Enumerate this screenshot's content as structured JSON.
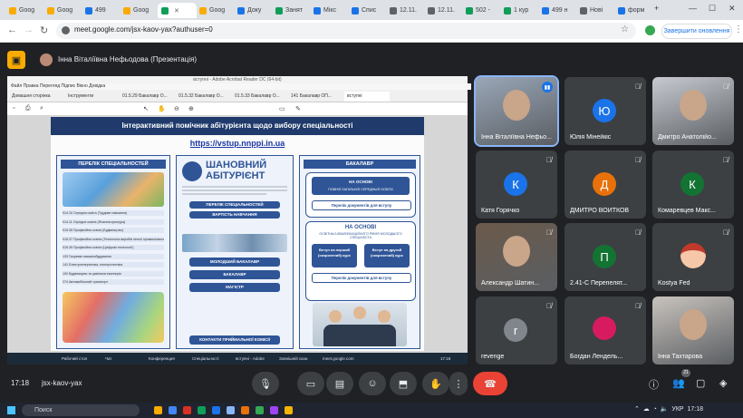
{
  "browser": {
    "tabs": [
      {
        "label": "Goog",
        "color": "#f9ab00"
      },
      {
        "label": "Goog",
        "color": "#f9ab00"
      },
      {
        "label": "499",
        "color": "#1a73e8"
      },
      {
        "label": "Goog",
        "color": "#f9ab00"
      },
      {
        "label": "",
        "color": "#0f9d58",
        "active": true
      },
      {
        "label": "Goog",
        "color": "#f9ab00"
      },
      {
        "label": "Доку",
        "color": "#1a73e8"
      },
      {
        "label": "Занят",
        "color": "#0f9d58"
      },
      {
        "label": "Мікс",
        "color": "#1a73e8"
      },
      {
        "label": "Спис",
        "color": "#1a73e8"
      },
      {
        "label": "12.11.",
        "color": "#5f6368"
      },
      {
        "label": "12.11.",
        "color": "#5f6368"
      },
      {
        "label": "502 -",
        "color": "#0f9d58"
      },
      {
        "label": "1 кур",
        "color": "#0f9d58"
      },
      {
        "label": "499 н",
        "color": "#1a73e8"
      },
      {
        "label": "Нові",
        "color": "#5f6368"
      },
      {
        "label": "форм",
        "color": "#1a73e8"
      }
    ],
    "url": "meet.google.com/jsx-kaov-yax?authuser=0",
    "update_button": "Завершити оновлення"
  },
  "meet": {
    "presenter_title": "Інна Віталіївна Нефьодова (Презентація)",
    "meeting_time": "17:18",
    "meeting_code": "jsx-kaov-yax",
    "participants_badge": "21",
    "participants": [
      {
        "name": "Інна Віталіївна Нефьо...",
        "type": "video",
        "color": "#9aa7b8",
        "active": true
      },
      {
        "name": "Юлія Мінейкіс",
        "initial": "Ю",
        "color": "#1a73e8",
        "muted": true
      },
      {
        "name": "Дмитро Анатолійо...",
        "type": "video",
        "color": "#c7cbd1",
        "muted": true
      },
      {
        "name": "Катя Горячко",
        "initial": "К",
        "color": "#1a73e8",
        "muted": true
      },
      {
        "name": "ДМИТРО ВОЙТКОВ",
        "initial": "Д",
        "color": "#e8710a",
        "muted": true
      },
      {
        "name": "Комаревцев Макс...",
        "initial": "К",
        "color": "#137333",
        "muted": true
      },
      {
        "name": "Александр Шатин...",
        "type": "video",
        "color": "#6b5a4a",
        "muted": true
      },
      {
        "name": "2.41-С Перепелят...",
        "initial": "П",
        "color": "#137333",
        "muted": true
      },
      {
        "name": "Kostya Fed",
        "type": "emoji",
        "color": "#3c4043",
        "muted": true
      },
      {
        "name": "revenge",
        "initial": "r",
        "color": "#80868b",
        "muted": true
      },
      {
        "name": "Богдан Лендель...",
        "type": "pink",
        "color": "#3c4043",
        "muted": true
      },
      {
        "name": "Інна Тахтарова",
        "type": "video",
        "color": "#c9c3bd"
      }
    ]
  },
  "shared_screen": {
    "acrobat_title": "вступні - Adobe Acrobat Reader DC (64-bit)",
    "acrobat_menu": "Файл   Правка   Перегляд   Підпис   Вікно   Довідка",
    "acrobat_tabs": [
      "Домашня сторінка",
      "Інструменти",
      "01.5.29 Бакалавр О...",
      "01.5.32 Бакалавр О...",
      "01.5.33 Бакалавр О...",
      "141 Бакалавр ОП...",
      "вступні"
    ],
    "page_title": "Інтерактивний помічник абітурієнта щодо вибору спеціальності",
    "page_link": "https://vstup.nnppi.in.ua",
    "col1": {
      "header": "ПЕРЕЛІК СПЕЦІАЛЬНОСТЕЙ",
      "items": [
        "014.10 Середня освіта (Трудове навчання)",
        "014.11 Середня освіта (Фізична культура)",
        "015.35 Професійна освіта (Будівництво)",
        "015.37 Професійна освіта (Технологія виробів легкої промисловості)",
        "015.39 Професійна освіта (Цифрові технології)",
        "133 Галузеве машинобудування",
        "141 Електроенергетика, електротехніка",
        "192 Будівництво та цивільна інженерія",
        "274 Автомобільний транспорт"
      ]
    },
    "col2": {
      "title_line1": "ШАНОВНИЙ",
      "title_line2": "АБІТУРІЄНТ",
      "buttons": [
        "ПЕРЕЛІК СПЕЦІАЛЬНОСТЕЙ",
        "ВАРТІСТЬ НАВЧАННЯ",
        "МОЛОДШИЙ БАКАЛАВР",
        "БАКАЛАВР",
        "МАГІСТР",
        "КОНТАКТИ ПРИЙМАЛЬНОЇ КОМІСІЇ"
      ]
    },
    "col3": {
      "header": "БАКАЛАВР",
      "box1_title": "НА ОСНОВІ",
      "box1_sub": "ПОВНОЇ ЗАГАЛЬНОЇ СЕРЕДНЬОЇ ОСВІТИ",
      "box1_btn": "Перелік документів для вступу",
      "box2_title": "НА ОСНОВІ",
      "box2_sub": "ОСВІТНЬО-КВАЛІФІКАЦІЙНОГО РІВНЯ МОЛОДШОГО СПЕЦІАЛІСТА",
      "opt1": "Вступ на перший (скорочений) курс",
      "opt2": "Вступ на другий (скорочений) курс",
      "box2_btn": "Перелік документів для вступу"
    },
    "win_taskbar": [
      "Рабочий стол",
      "Чат",
      "Конференция",
      "Спеціальності",
      "вступні - Adobe",
      "Зовнішній скан.",
      "meet.google.com"
    ],
    "win_clock": "17:18"
  },
  "taskbar": {
    "search_placeholder": "Поиск",
    "tray_lang": "УКР",
    "tray_time": "17:18"
  }
}
